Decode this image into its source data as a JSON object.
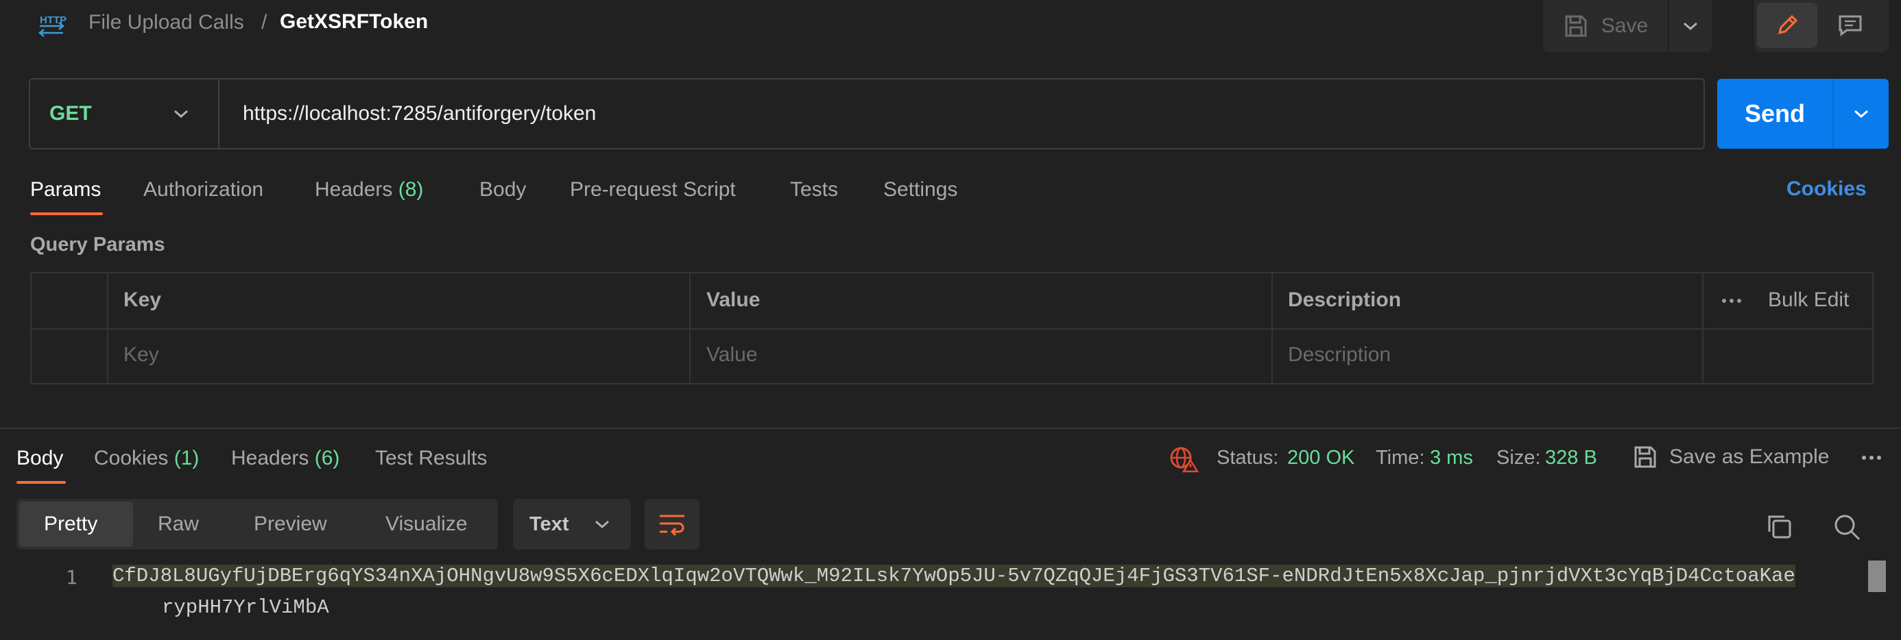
{
  "header": {
    "http_badge": "HTTP",
    "breadcrumb_parent": "File Upload Calls",
    "breadcrumb_separator": "/",
    "request_name": "GetXSRFToken",
    "save_label": "Save"
  },
  "request": {
    "method": "GET",
    "url": "https://localhost:7285/antiforgery/token",
    "send_label": "Send"
  },
  "request_tabs": [
    {
      "label": "Params",
      "count": "",
      "active": true
    },
    {
      "label": "Authorization",
      "count": ""
    },
    {
      "label": "Headers",
      "count": "(8)"
    },
    {
      "label": "Body",
      "count": ""
    },
    {
      "label": "Pre-request Script",
      "count": ""
    },
    {
      "label": "Tests",
      "count": ""
    },
    {
      "label": "Settings",
      "count": ""
    }
  ],
  "cookies_link": "Cookies",
  "query_params": {
    "title": "Query Params",
    "columns": [
      "Key",
      "Value",
      "Description"
    ],
    "bulk_edit": "Bulk Edit",
    "placeholders": {
      "key": "Key",
      "value": "Value",
      "description": "Description"
    }
  },
  "response_tabs": [
    {
      "label": "Body",
      "count": "",
      "active": true
    },
    {
      "label": "Cookies",
      "count": "(1)"
    },
    {
      "label": "Headers",
      "count": "(6)"
    },
    {
      "label": "Test Results",
      "count": ""
    }
  ],
  "response_meta": {
    "status_label": "Status:",
    "status_value": "200 OK",
    "time_label": "Time:",
    "time_value": "3 ms",
    "size_label": "Size:",
    "size_value": "328 B",
    "save_example": "Save as Example"
  },
  "view_options": [
    "Pretty",
    "Raw",
    "Preview",
    "Visualize"
  ],
  "format": "Text",
  "body": {
    "line_number": "1",
    "line1": "CfDJ8L8UGyfUjDBErg6qYS34nXAjOHNgvU8w9S5X6cEDXlqIqw2oVTQWwk_M92ILsk7YwOp5JU-5v7QZqQJEj4FjGS3TV61SF-eNDRdJtEn5x8XcJap_pjnrjdVXt3cYqBjD4CctoaKae",
    "line2": "rypHH7YrlViMbA"
  },
  "colors": {
    "accent": "#ff6c37",
    "send": "#097bed",
    "success": "#6bdd9a",
    "link": "#3d8fe6"
  },
  "icons": [
    "http-icon",
    "save-icon",
    "chevron-down-icon",
    "pencil-icon",
    "comment-icon",
    "globe-error-icon",
    "more-icon",
    "copy-icon",
    "search-icon",
    "wrap-icon"
  ]
}
